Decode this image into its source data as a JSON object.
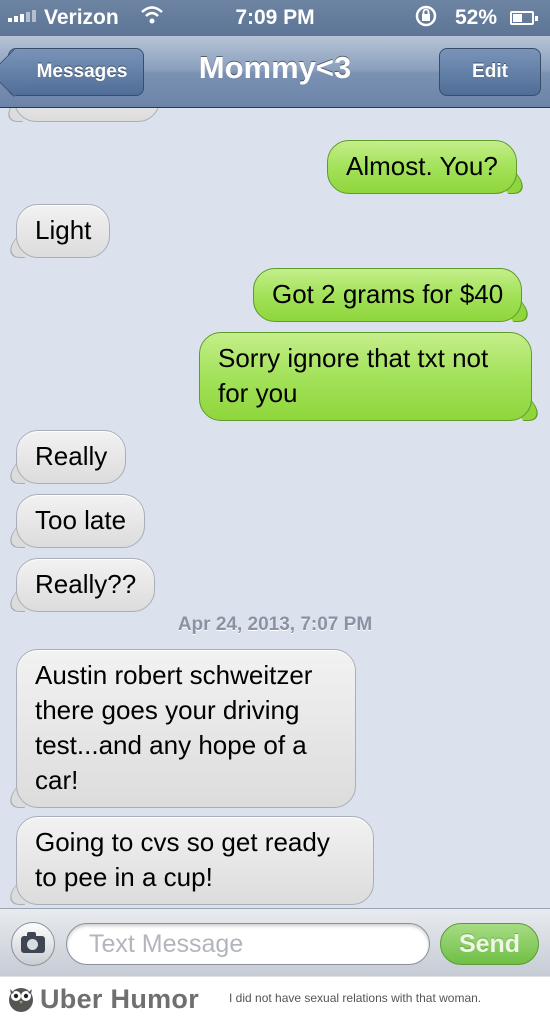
{
  "status_bar": {
    "carrier": "Verizon",
    "time": "7:09 PM",
    "battery": "52%"
  },
  "nav": {
    "back_label": "Messages",
    "title": "Mommy<3",
    "edit_label": "Edit"
  },
  "messages": [
    {
      "from": "me",
      "text": "Almost. You?"
    },
    {
      "from": "them",
      "text": "Light"
    },
    {
      "from": "me",
      "text": "Got 2 grams for $40"
    },
    {
      "from": "me",
      "text": "Sorry ignore that txt not for you"
    },
    {
      "from": "them",
      "text": "Really"
    },
    {
      "from": "them",
      "text": "Too late"
    },
    {
      "from": "them",
      "text": "Really??"
    },
    {
      "from": "them",
      "text": "Austin robert schweitzer there goes your driving test...and any hope of a car!"
    },
    {
      "from": "them",
      "text": "Going to cvs so get ready to pee in a cup!"
    }
  ],
  "timestamp": "Apr 24, 2013, 7:07 PM",
  "composer": {
    "placeholder": "Text Message",
    "send_label": "Send"
  },
  "footer": {
    "brand": "Uber Humor",
    "tagline": "I did not have sexual relations with that woman."
  },
  "colors": {
    "outgoing_bubble": "#a3e25a",
    "incoming_bubble": "#e6e6e6",
    "nav_bar": "#7a91b2",
    "background": "#dbe2ed"
  }
}
